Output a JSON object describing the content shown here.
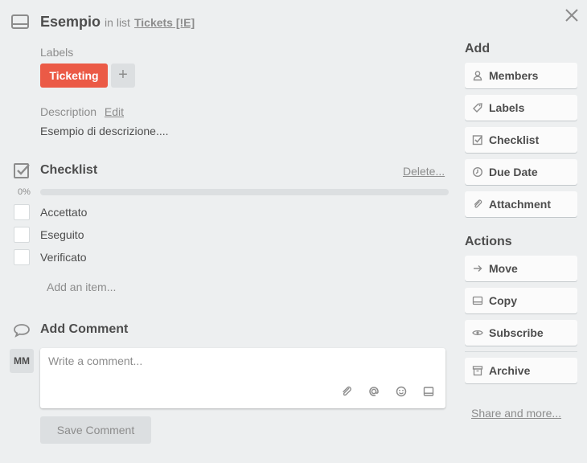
{
  "card": {
    "title": "Esempio",
    "in_list_prefix": "in list",
    "list_name": "Tickets [!E]"
  },
  "labels": {
    "heading": "Labels",
    "items": [
      {
        "text": "Ticketing",
        "color": "#eb5a46"
      }
    ],
    "add_symbol": "+"
  },
  "description": {
    "heading": "Description",
    "edit_label": "Edit",
    "text": "Esempio di descrizione...."
  },
  "checklist": {
    "title": "Checklist",
    "delete_label": "Delete...",
    "progress_label": "0%",
    "progress": 0,
    "items": [
      {
        "text": "Accettato",
        "checked": false
      },
      {
        "text": "Eseguito",
        "checked": false
      },
      {
        "text": "Verificato",
        "checked": false
      }
    ],
    "add_item_label": "Add an item..."
  },
  "comment": {
    "title": "Add Comment",
    "avatar_initials": "MM",
    "placeholder": "Write a comment...",
    "tools": [
      "attachment-icon",
      "mention-icon",
      "emoji-icon",
      "card-icon"
    ],
    "save_label": "Save Comment"
  },
  "sidebar": {
    "add_heading": "Add",
    "add_buttons": [
      {
        "label": "Members",
        "icon": "person-icon"
      },
      {
        "label": "Labels",
        "icon": "tag-icon"
      },
      {
        "label": "Checklist",
        "icon": "checkbox-icon"
      },
      {
        "label": "Due Date",
        "icon": "clock-icon"
      },
      {
        "label": "Attachment",
        "icon": "paperclip-icon"
      }
    ],
    "actions_heading": "Actions",
    "action_buttons": [
      {
        "label": "Move",
        "icon": "arrow-right-icon"
      },
      {
        "label": "Copy",
        "icon": "card-icon"
      },
      {
        "label": "Subscribe",
        "icon": "eye-icon"
      },
      {
        "label": "Archive",
        "icon": "archive-icon"
      }
    ],
    "share_label": "Share and more..."
  }
}
